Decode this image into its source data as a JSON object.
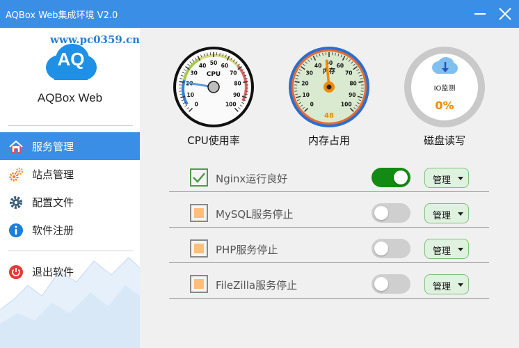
{
  "window": {
    "title": "AQBox Web集成环境 V2.0",
    "watermark": "www.pc0359.cn"
  },
  "sidebar": {
    "logo_text": "AQ",
    "app_name": "AQBox Web",
    "items": [
      {
        "label": "服务管理",
        "icon": "home-icon",
        "active": true
      },
      {
        "label": "站点管理",
        "icon": "gears-icon",
        "active": false
      },
      {
        "label": "配置文件",
        "icon": "gear-icon",
        "active": false
      },
      {
        "label": "软件注册",
        "icon": "info-icon",
        "active": false
      },
      {
        "label": "退出软件",
        "icon": "power-icon",
        "active": false
      }
    ]
  },
  "gauges": {
    "cpu": {
      "label": "CPU",
      "caption": "CPU使用率",
      "ticks": [
        "0",
        "10",
        "20",
        "30",
        "40",
        "50",
        "60",
        "70",
        "80",
        "90",
        "100"
      ],
      "value": 20
    },
    "memory": {
      "label": "内存",
      "caption": "内存占用",
      "ticks": [
        "0",
        "10",
        "20",
        "30",
        "40",
        "50",
        "60",
        "70",
        "80",
        "90",
        "100"
      ],
      "value": 48,
      "value_text": "48"
    },
    "disk": {
      "label": "IO监测",
      "caption": "磁盘读写",
      "value_text": "0%"
    }
  },
  "services": [
    {
      "name": "Nginx运行良好",
      "checked": true,
      "running": true,
      "manage_label": "管理"
    },
    {
      "name": "MySQL服务停止",
      "checked": false,
      "running": false,
      "manage_label": "管理"
    },
    {
      "name": "PHP服务停止",
      "checked": false,
      "running": false,
      "manage_label": "管理"
    },
    {
      "name": "FileZilla服务停止",
      "checked": false,
      "running": false,
      "manage_label": "管理"
    }
  ],
  "colors": {
    "accent": "#3a8ee6",
    "toggle_on": "#138a13",
    "toggle_off": "#cfcfcf",
    "manage_bg": "#dff1df",
    "manage_border": "#7cc17c",
    "memory_value": "#f08a00",
    "disk_value": "#f08a00",
    "cpu_needle": "#5a9bd8",
    "memory_needle": "#f08a00"
  }
}
